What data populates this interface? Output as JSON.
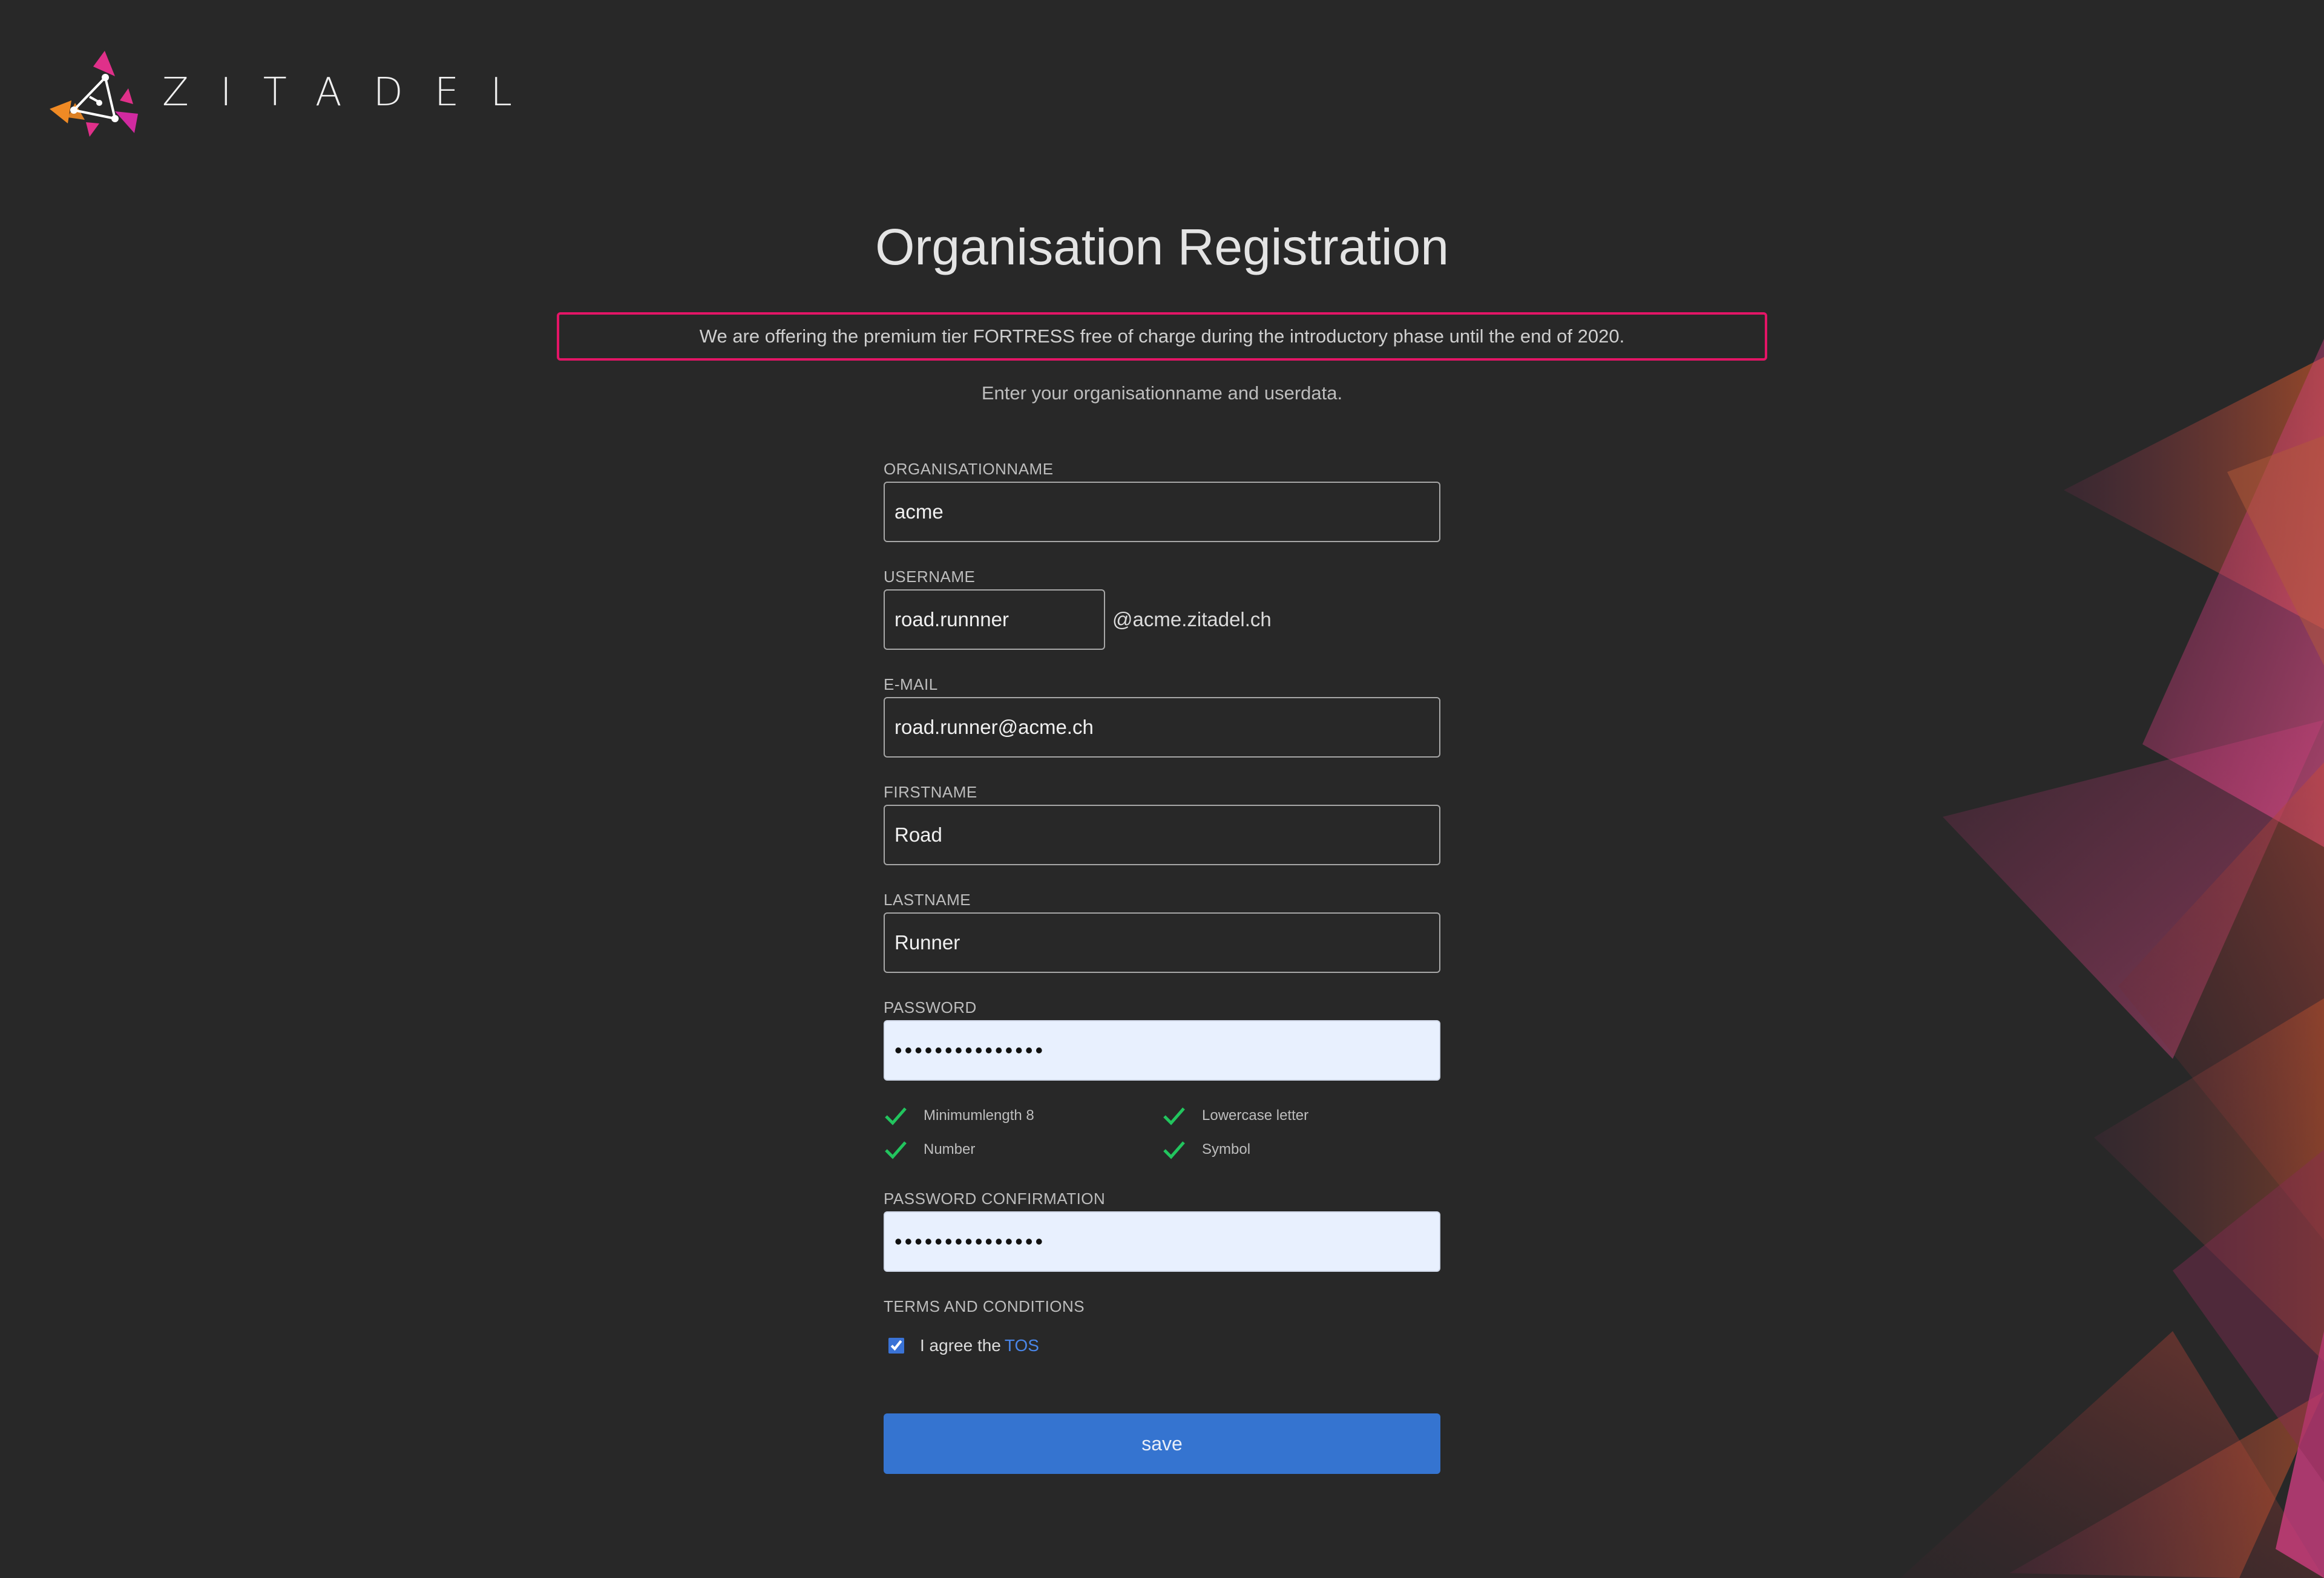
{
  "brand": {
    "name": "ZITADEL"
  },
  "page": {
    "title": "Organisation Registration",
    "promo": "We are offering the premium tier FORTRESS free of charge during the introductory phase until the end of 2020.",
    "subtitle": "Enter your organisationname and userdata."
  },
  "form": {
    "organisation": {
      "label": "ORGANISATIONNAME",
      "value": "acme"
    },
    "username": {
      "label": "USERNAME",
      "value": "road.runnner",
      "suffix": "@acme.zitadel.ch"
    },
    "email": {
      "label": "E-MAIL",
      "value": "road.runner@acme.ch"
    },
    "firstname": {
      "label": "FIRSTNAME",
      "value": "Road"
    },
    "lastname": {
      "label": "LASTNAME",
      "value": "Runner"
    },
    "password": {
      "label": "PASSWORD",
      "value": "•••••••••••••••"
    },
    "password_rules": [
      {
        "label": "Minimumlength 8",
        "ok": true
      },
      {
        "label": "Lowercase letter",
        "ok": true
      },
      {
        "label": "Number",
        "ok": true
      },
      {
        "label": "Symbol",
        "ok": true
      }
    ],
    "password_confirmation": {
      "label": "PASSWORD CONFIRMATION",
      "value": "•••••••••••••••"
    },
    "terms": {
      "label": "TERMS AND CONDITIONS",
      "agree_text": "I agree the",
      "link_text": "TOS",
      "checked": true
    },
    "save_label": "save"
  },
  "colors": {
    "accent": "#3574d0",
    "promo_border": "#e31566",
    "check": "#22c55e",
    "background": "#282828"
  }
}
